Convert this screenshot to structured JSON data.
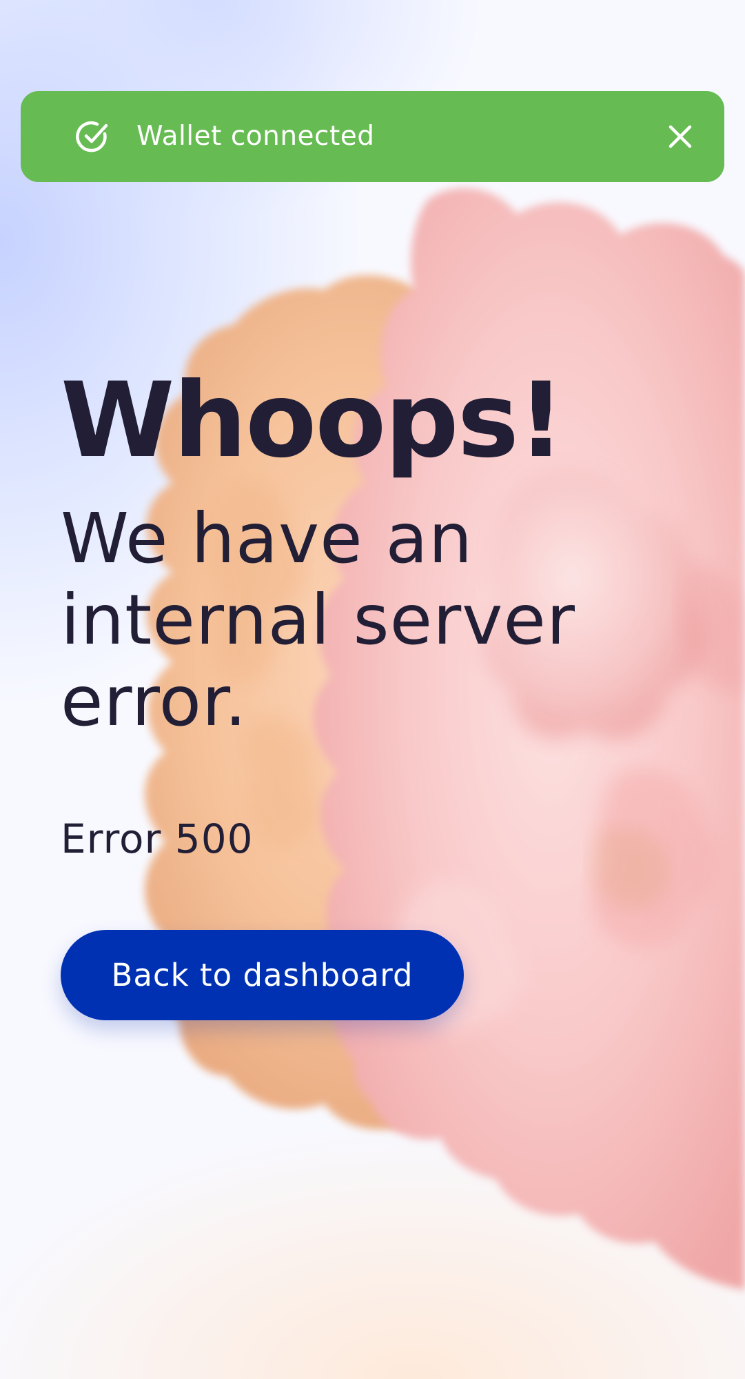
{
  "toast": {
    "message": "Wallet connected",
    "status_icon": "check-circle-icon",
    "close_icon": "close-icon",
    "color": "#66bb52"
  },
  "content": {
    "headline": "Whoops!",
    "subline": "We have an internal server error.",
    "error_code": "Error 500",
    "back_button_label": "Back to dashboard",
    "button_color": "#0031b3",
    "text_color": "#211e36"
  }
}
